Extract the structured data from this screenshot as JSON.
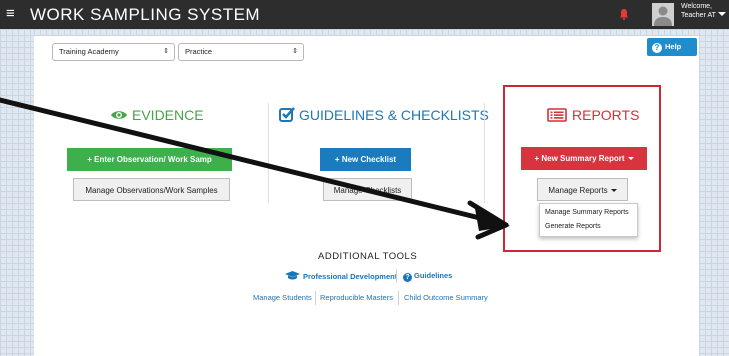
{
  "header": {
    "menu_icon": "hamburger-icon",
    "title": "WORK SAMPLING SYSTEM",
    "alert_icon": "bell-icon",
    "avatar_icon": "user-avatar-icon",
    "welcome_line1": "Welcome,",
    "welcome_line2": "Teacher AT",
    "welcome_caret_icon": "chevron-down-icon"
  },
  "filters": {
    "program": "Training Academy",
    "site": "Practice"
  },
  "help": {
    "icon": "question-circle-icon",
    "label": "Help"
  },
  "sections": {
    "evidence": {
      "icon": "eye-icon",
      "title": "EVIDENCE",
      "primary_button": "+ Enter Observation/ Work Samp",
      "secondary_button": "Manage Observations/Work Samples"
    },
    "guidelines": {
      "icon": "checkbox-icon",
      "title": "GUIDELINES & CHECKLISTS",
      "primary_button": "+ New Checklist",
      "secondary_button": "Manage Checklists"
    },
    "reports": {
      "icon": "report-list-icon",
      "title": "REPORTS",
      "primary_button": "+ New Summary Report",
      "secondary_button": "Manage Reports",
      "dropdown_items": [
        "Manage Summary Reports",
        "Generate Reports"
      ]
    }
  },
  "tools": {
    "title": "ADDITIONAL TOOLS",
    "professional_development": "Professional Development",
    "guidelines": "Guidelines",
    "links": [
      "Manage Students",
      "Reproducible Masters",
      "Child Outcome Summary"
    ]
  },
  "colors": {
    "header_bg": "#2d2d2d",
    "evidence_green": "#3eb04b",
    "guidelines_blue": "#1a7bbf",
    "reports_red": "#d7343f",
    "highlight_box": "#c62b35",
    "link_blue": "#1a74b8"
  }
}
